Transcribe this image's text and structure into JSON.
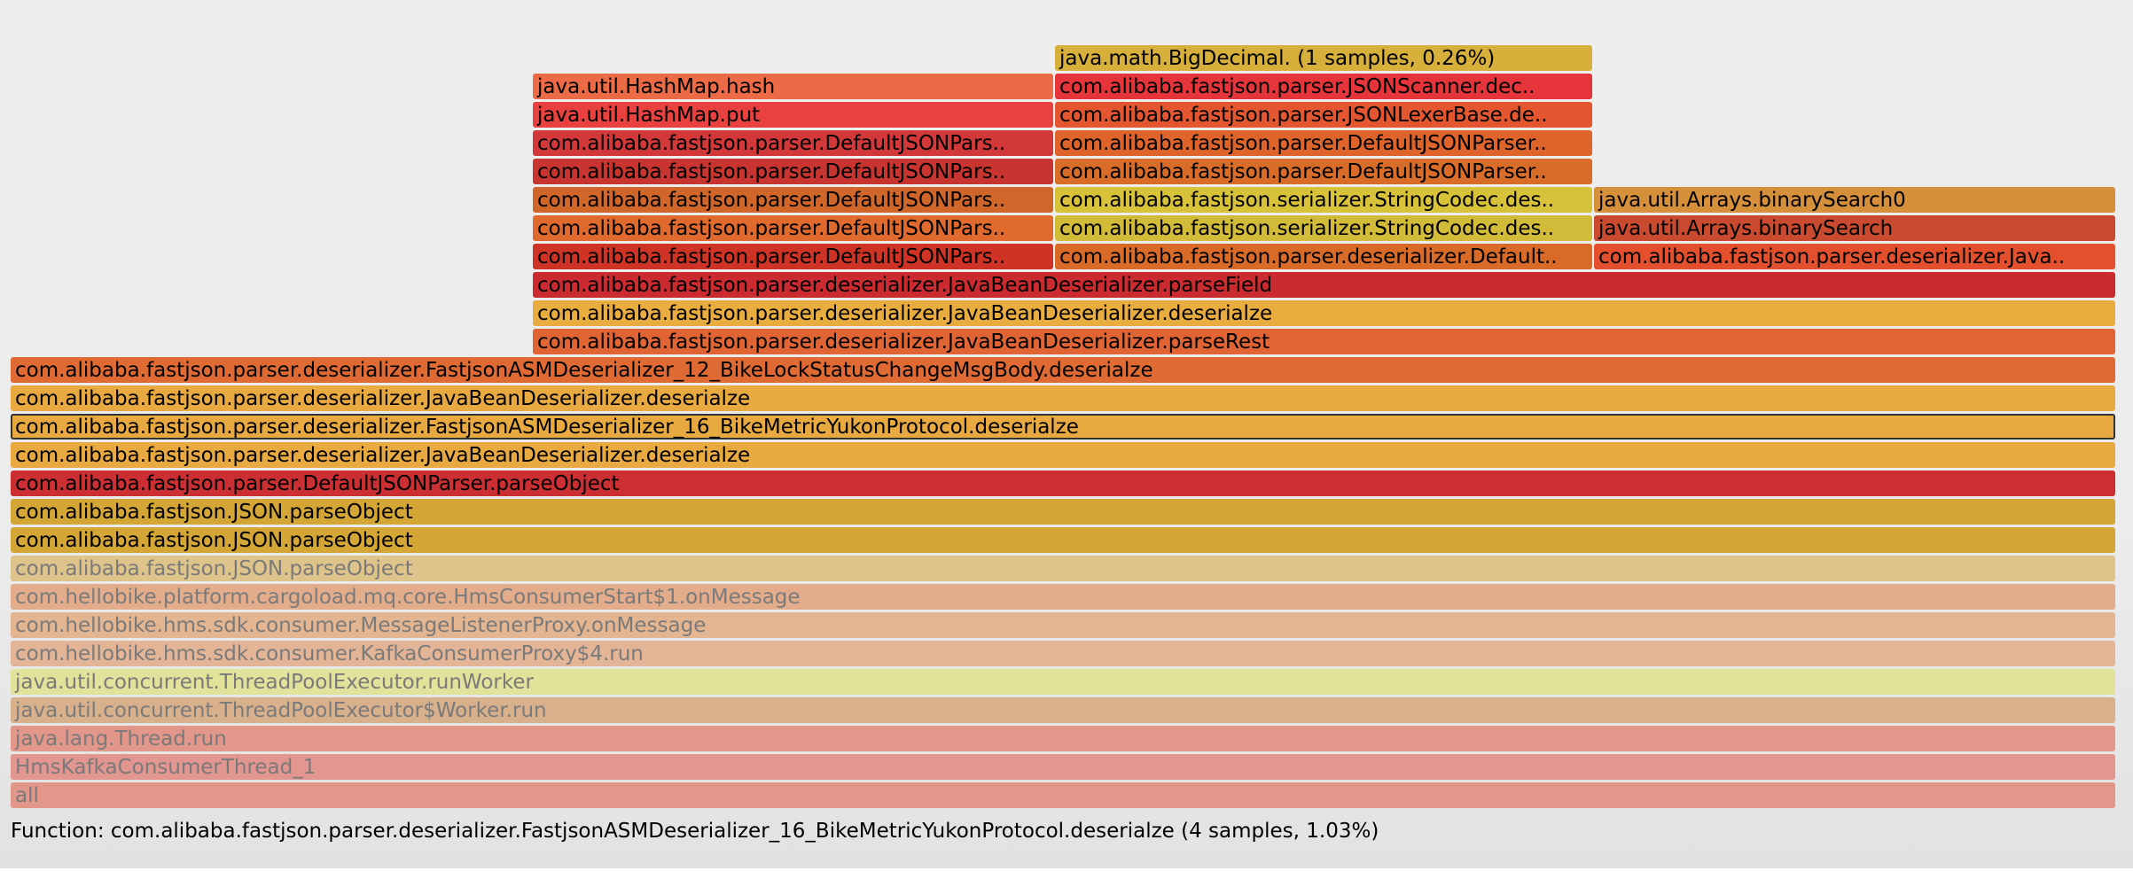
{
  "details": {
    "text": "Function: com.alibaba.fastjson.parser.deserializer.FastjsonASMDeserializer_16_BikeMetricYukonProtocol.deserialze (4 samples, 1.03%)"
  },
  "frames": [
    {
      "label": "all",
      "color": "#e3978b",
      "dim": true
    },
    {
      "label": "HmsKafkaConsumerThread_1",
      "color": "#e39590",
      "dim": true
    },
    {
      "label": "java.lang.Thread.run",
      "color": "#e3968a",
      "dim": true
    },
    {
      "label": "java.util.concurrent.ThreadPoolExecutor$Worker.run",
      "color": "#d9b08c",
      "dim": true
    },
    {
      "label": "java.util.concurrent.ThreadPoolExecutor.runWorker",
      "color": "#e3e29b",
      "dim": true
    },
    {
      "label": "com.hellobike.hms.sdk.consumer.KafkaConsumerProxy$4.run",
      "color": "#e3b596",
      "dim": true
    },
    {
      "label": "com.hellobike.hms.sdk.consumer.MessageListenerProxy.onMessage",
      "color": "#e3b590",
      "dim": true
    },
    {
      "label": "com.hellobike.platform.cargoload.mq.core.HmsConsumerStart$1.onMessage",
      "color": "#e3ad8c",
      "dim": true
    },
    {
      "label": "com.alibaba.fastjson.JSON.parseObject",
      "color": "#dec48a",
      "dim": true
    },
    {
      "label": "com.alibaba.fastjson.JSON.parseObject",
      "color": "#d4a636",
      "dim": false
    },
    {
      "label": "com.alibaba.fastjson.JSON.parseObject",
      "color": "#d4a636",
      "dim": false
    },
    {
      "label": "com.alibaba.fastjson.parser.DefaultJSONParser.parseObject",
      "color": "#cc2f33",
      "dim": false
    },
    {
      "label": "com.alibaba.fastjson.parser.deserializer.JavaBeanDeserializer.deserialze",
      "color": "#e8aa40",
      "dim": false
    },
    {
      "label": "com.alibaba.fastjson.parser.deserializer.FastjsonASMDeserializer_16_BikeMetricYukonProtocol.deserialze",
      "color": "#e8aa40",
      "dim": false,
      "selected": true
    },
    {
      "label": "com.alibaba.fastjson.parser.deserializer.JavaBeanDeserializer.deserialze",
      "color": "#e8aa40",
      "dim": false
    },
    {
      "label": "com.alibaba.fastjson.parser.deserializer.FastjsonASMDeserializer_12_BikeLockStatusChangeMsgBody.deserialze",
      "color": "#e06a33",
      "dim": false
    },
    {
      "label": "com.alibaba.fastjson.parser.deserializer.JavaBeanDeserializer.parseRest",
      "color": "#e06434",
      "dim": false
    },
    {
      "label": "com.alibaba.fastjson.parser.deserializer.JavaBeanDeserializer.deserialze",
      "color": "#e9ac3f",
      "dim": false
    },
    {
      "label": "com.alibaba.fastjson.parser.deserializer.JavaBeanDeserializer.parseField",
      "color": "#cb2a30",
      "dim": false
    },
    {
      "label": "com.alibaba.fastjson.parser.DefaultJSONPars..",
      "color": "#cf3325",
      "dim": false
    },
    {
      "label": "com.alibaba.fastjson.parser.DefaultJSONPars..",
      "color": "#e06a2e",
      "dim": false
    },
    {
      "label": "com.alibaba.fastjson.parser.DefaultJSONPars..",
      "color": "#d0662a",
      "dim": false
    },
    {
      "label": "com.alibaba.fastjson.parser.DefaultJSONPars..",
      "color": "#c83430",
      "dim": false
    },
    {
      "label": "com.alibaba.fastjson.parser.DefaultJSONPars..",
      "color": "#d2383a",
      "dim": false
    },
    {
      "label": "java.util.HashMap.put",
      "color": "#e94040",
      "dim": false
    },
    {
      "label": "java.util.HashMap.hash",
      "color": "#ec6a45",
      "dim": false
    },
    {
      "label": "com.alibaba.fastjson.parser.deserializer.Default..",
      "color": "#d96a28",
      "dim": false
    },
    {
      "label": "com.alibaba.fastjson.serializer.StringCodec.des..",
      "color": "#d2bb38",
      "dim": false
    },
    {
      "label": "com.alibaba.fastjson.serializer.StringCodec.des..",
      "color": "#d7c23a",
      "dim": false
    },
    {
      "label": "com.alibaba.fastjson.parser.DefaultJSONParser..",
      "color": "#d86c28",
      "dim": false
    },
    {
      "label": "com.alibaba.fastjson.parser.DefaultJSONParser..",
      "color": "#de642c",
      "dim": false
    },
    {
      "label": "com.alibaba.fastjson.parser.JSONLexerBase.de..",
      "color": "#e45630",
      "dim": false
    },
    {
      "label": "com.alibaba.fastjson.parser.JSONScanner.dec..",
      "color": "#e5343a",
      "dim": false
    },
    {
      "label": "java.math.BigDecimal. (1 samples, 0.26%)",
      "color": "#d6b03a",
      "dim": false
    },
    {
      "label": "com.alibaba.fastjson.parser.deserializer.Java..",
      "color": "#e4502e",
      "dim": false
    },
    {
      "label": "java.util.Arrays.binarySearch",
      "color": "#c94a2e",
      "dim": false
    },
    {
      "label": "java.util.Arrays.binarySearch0",
      "color": "#d68f3a",
      "dim": false
    }
  ]
}
